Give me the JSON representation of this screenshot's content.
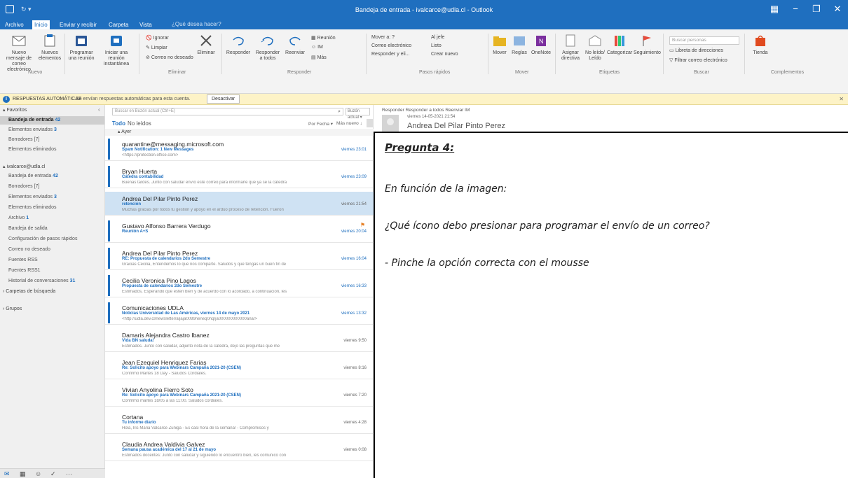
{
  "window": {
    "title": "Bandeja de entrada - ivalcarce@udla.cl - Outlook",
    "controls": [
      "▦",
      "−",
      "❐",
      "✕"
    ]
  },
  "tabs": [
    "Archivo",
    "Inicio",
    "Enviar y recibir",
    "Carpeta",
    "Vista"
  ],
  "tell_me": "¿Qué desea hacer?",
  "ribbon": {
    "new_email": "Nuevo mensaje de correo electrónico",
    "new_items": "Nuevos elementos",
    "schedule": "Programar una reunión",
    "start_meeting": "Iniciar una reunión instantánea",
    "ignore": "Ignorar",
    "cleanup": "Limpiar",
    "junk": "Correo no deseado",
    "delete": "Eliminar",
    "reply": "Responder",
    "reply_all": "Responder a todos",
    "forward": "Reenviar",
    "meeting": "Reunión",
    "im": "IM",
    "more": "Más",
    "quick1": "Mover a: ?",
    "quick2": "Correo electrónico",
    "quick3": "Responder y eli...",
    "quick4": "Al jefe",
    "quick5": "Listo",
    "quick6": "Crear nuevo",
    "move": "Mover",
    "rules": "Reglas",
    "onenote": "OneNote",
    "assign": "Asignar directiva",
    "unread": "No leído/ Leído",
    "categorize": "Categorizar",
    "followup": "Seguimiento",
    "search_people": "Buscar personas",
    "address_book": "Libreta de direcciones",
    "filter_email": "Filtrar correo electrónico",
    "store": "Tienda",
    "groups": [
      "Nuevo",
      "Eliminar",
      "Responder",
      "Pasos rápidos",
      "Mover",
      "Etiquetas",
      "Buscar",
      "Complementos"
    ]
  },
  "infobar": {
    "title": "RESPUESTAS AUTOMÁTICAS",
    "text": "Se envían respuestas automáticas para esta cuenta.",
    "button": "Desactivar"
  },
  "folders": {
    "favorites_label": "Favoritos",
    "favorites": [
      {
        "name": "Bandeja de entrada",
        "count": "42",
        "selected": true
      },
      {
        "name": "Elementos enviados",
        "count": "3",
        "selected": false
      },
      {
        "name": "Borradores",
        "count": "[7]",
        "selected": false
      },
      {
        "name": "Elementos eliminados",
        "count": "",
        "selected": false
      }
    ],
    "account": "ivalcarce@udla.cl",
    "account_items": [
      {
        "name": "Bandeja de entrada",
        "count": "42"
      },
      {
        "name": "Borradores",
        "count": "[7]"
      },
      {
        "name": "Elementos enviados",
        "count": "3"
      },
      {
        "name": "Elementos eliminados",
        "count": ""
      },
      {
        "name": "Archivo",
        "count": "1"
      },
      {
        "name": "Bandeja de salida",
        "count": ""
      },
      {
        "name": "Configuración de pasos rápidos",
        "count": ""
      },
      {
        "name": "Correo no deseado",
        "count": ""
      },
      {
        "name": "Fuentes RSS",
        "count": ""
      },
      {
        "name": "Fuentes RSS1",
        "count": ""
      },
      {
        "name": "Historial de conversaciones",
        "count": "31"
      }
    ],
    "search_folders": "Carpetas de búsqueda",
    "groups": "Grupos"
  },
  "msglist": {
    "search_placeholder": "Buscar en Buzón actual (Ctrl+E)",
    "mailbox": "Buzón actual",
    "filter_all": "Todo",
    "filter_unread": "No leídos",
    "sort": "Por Fecha",
    "order": "Más nuevo",
    "group": "Ayer",
    "messages": [
      {
        "from": "quarantine@messaging.microsoft.com",
        "subject": "Spam Notification: 1 New Messages",
        "preview": "<https://protection.office.com>",
        "time": "viernes 23:01",
        "unread": true,
        "selected": false,
        "flag": ""
      },
      {
        "from": "Bryan Huerta",
        "subject": "Cátedra contabilidad",
        "preview": "Buenas tardes. Junto con saludar envío este correo para informarle que ya se la cátedra",
        "time": "viernes 23:09",
        "unread": true,
        "selected": false,
        "flag": ""
      },
      {
        "from": "Andrea Del Pilar Pinto Perez",
        "subject": "retención",
        "preview": "Muchas gracias por todos tu gestión y apoyo en el arduo proceso de retención. Fueron",
        "time": "viernes 21:54",
        "unread": false,
        "selected": true,
        "flag": ""
      },
      {
        "from": "Gustavo Alfonso Barrera Verdugo",
        "subject": "Reunión A+S",
        "preview": "",
        "time": "viernes 20:04",
        "unread": true,
        "selected": false,
        "flag": "⚑"
      },
      {
        "from": "Andrea Del Pilar Pinto Perez",
        "subject": "RE: Propuesta de calendarios 2do Semestre",
        "preview": "Gracias Cecilia, Entendemos lo que nos comparte. Saludos y que tengas un buen fin de",
        "time": "viernes 16:04",
        "unread": true,
        "selected": false,
        "flag": ""
      },
      {
        "from": "Cecilia Veronica Pino Lagos",
        "subject": "Propuesta de calendarios 2do Semestre",
        "preview": "Estimados, Esperando que estén bien y de acuerdo con lo acordado, a continuación, les",
        "time": "viernes 16:33",
        "unread": true,
        "selected": false,
        "flag": ""
      },
      {
        "from": "Comunicaciones UDLA",
        "subject": "Noticias Universidad de Las Américas, viernes 14 de mayo 2021",
        "preview": "<http://udla.dev.cl/newsletter/aljaja0099neneq0nq/ja000000000000ana/>",
        "time": "viernes 13:32",
        "unread": true,
        "selected": false,
        "flag": ""
      },
      {
        "from": "Damaris Alejandra Castro Ibanez",
        "subject": "Vida BN saluda!",
        "preview": "Estimados. Junto con saludar, adjunto nota de la cátedra, dejo las preguntas que me",
        "time": "viernes 9:50",
        "unread": false,
        "selected": false,
        "flag": ""
      },
      {
        "from": "Jean Ezequiel Henriquez Farias",
        "subject": "Re: Solicito apoyo para Webinars Campaña 2021-20 (CSEN)",
        "preview": "Confirmo Martes 18 Day - Saludos Cordiales.",
        "time": "viernes 8:16",
        "unread": false,
        "selected": false,
        "flag": ""
      },
      {
        "from": "Vivian Anyolina Fierro Soto",
        "subject": "Re: Solicito apoyo para Webinars Campaña 2021-20 (CSEN)",
        "preview": "Confirmo martes 18/05 a las 11:00. Saludos cordiales.",
        "time": "viernes 7:20",
        "unread": false,
        "selected": false,
        "flag": ""
      },
      {
        "from": "Cortana",
        "subject": "Tu informe diario",
        "preview": "Hola, Iris Maria Valcarce Zuniga - Es casi hora de la semana! - Compromisos y",
        "time": "viernes 4:28",
        "unread": false,
        "selected": false,
        "flag": ""
      },
      {
        "from": "Claudia Andrea Valdivia Galvez",
        "subject": "Semana pausa académica del 17 al 21 de mayo",
        "preview": "Estimados docentes: Junto con saludar y siguiendo lo encuentro bien, les comunico con",
        "time": "viernes 0:08",
        "unread": false,
        "selected": false,
        "flag": ""
      }
    ]
  },
  "reading": {
    "actions": "Responder   Responder a todos   Reenviar   IM",
    "date": "viernes 14-05-2021 21:54",
    "from": "Andrea Del Pilar Pinto Perez"
  },
  "question": {
    "heading": "Pregunta 4:",
    "line1": "En función de la imagen:",
    "line2": "¿Qué ícono debo presionar para programar el envío de un correo?",
    "line3": "- Pinche la opción correcta con el mousse"
  }
}
